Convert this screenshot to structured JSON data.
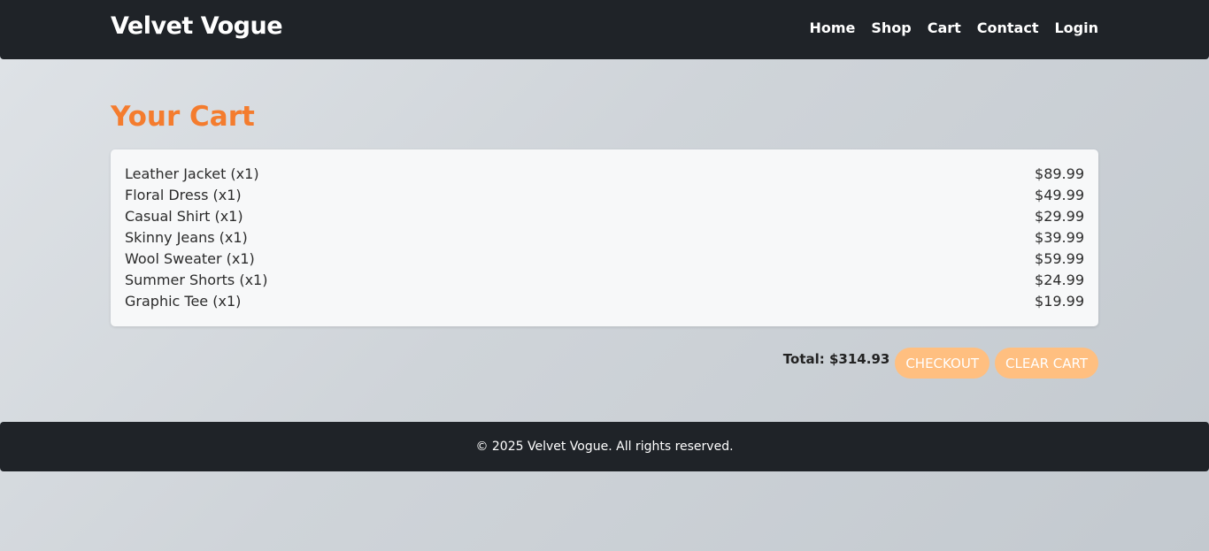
{
  "navbar": {
    "brand": "Velvet Vogue",
    "links": [
      "Home",
      "Shop",
      "Cart",
      "Contact",
      "Login"
    ]
  },
  "main": {
    "title": "Your Cart",
    "items": [
      {
        "name": "Leather Jacket (x1)",
        "price": "$89.99"
      },
      {
        "name": "Floral Dress (x1)",
        "price": "$49.99"
      },
      {
        "name": "Casual Shirt (x1)",
        "price": "$29.99"
      },
      {
        "name": "Skinny Jeans (x1)",
        "price": "$39.99"
      },
      {
        "name": "Wool Sweater (x1)",
        "price": "$59.99"
      },
      {
        "name": "Summer Shorts (x1)",
        "price": "$24.99"
      },
      {
        "name": "Graphic Tee (x1)",
        "price": "$19.99"
      }
    ],
    "total": "Total: $314.93",
    "checkout_label": "CHECKOUT",
    "clear_label": "CLEAR CART"
  },
  "footer": {
    "text": "© 2025 Velvet Vogue. All rights reserved."
  },
  "colors": {
    "nav_bg": "#1f2328",
    "accent": "#f47c2e",
    "button_bg": "#ffbf80"
  }
}
